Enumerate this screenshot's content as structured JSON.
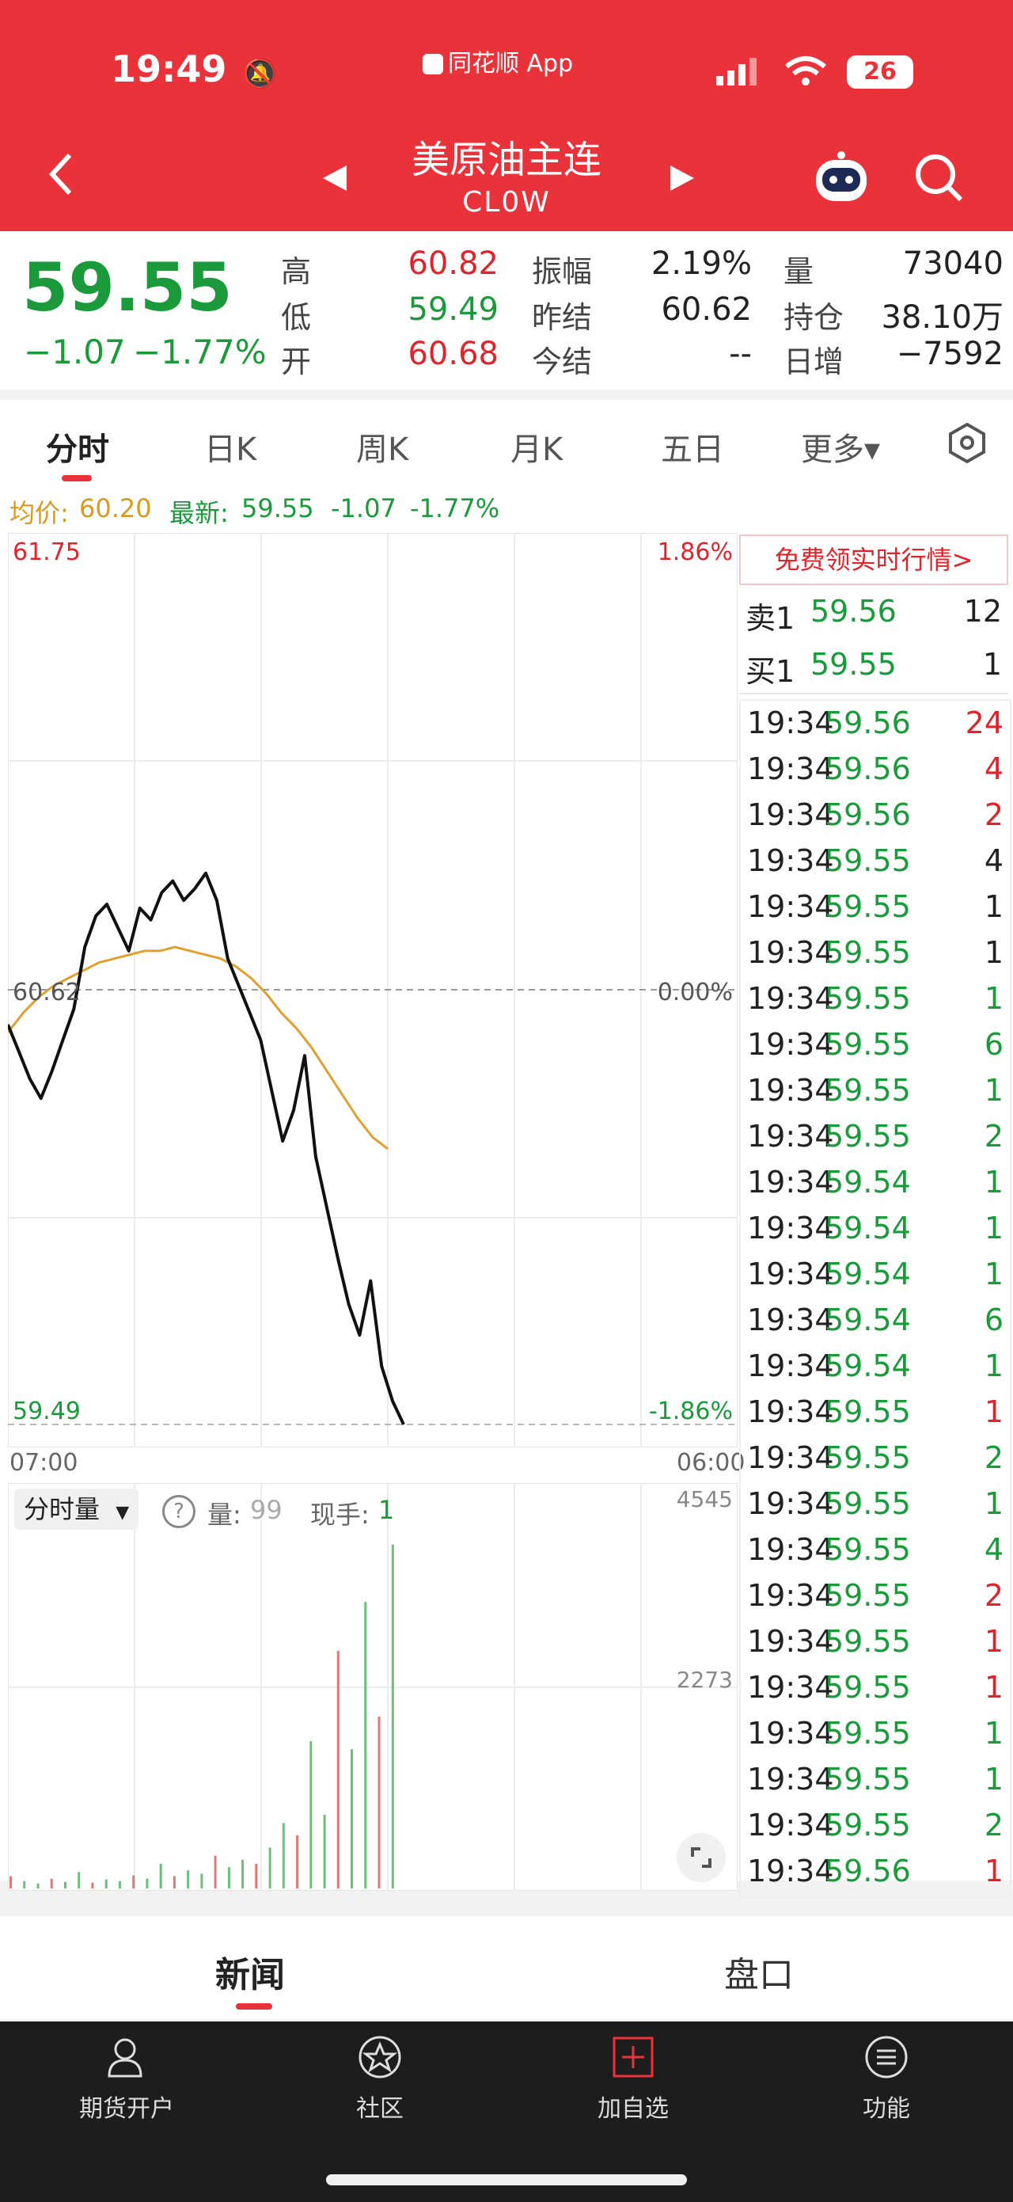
{
  "status": {
    "time": "19:49",
    "app_label": "同花顺 App",
    "battery": "26"
  },
  "header": {
    "title": "美原油主连",
    "code": "CL0W"
  },
  "quote": {
    "price": "59.55",
    "change": "−1.07",
    "change_pct": "−1.77%",
    "high_label": "高",
    "high": "60.82",
    "low_label": "低",
    "low": "59.49",
    "open_label": "开",
    "open": "60.68",
    "amp_label": "振幅",
    "amp": "2.19%",
    "prev_settle_label": "昨结",
    "prev_settle": "60.62",
    "settle_label": "今结",
    "settle": "--",
    "vol_label": "量",
    "vol": "73040",
    "oi_label": "持仓",
    "oi": "38.10万",
    "daily_inc_label": "日增",
    "daily_inc": "−7592"
  },
  "tabs": [
    "分时",
    "日K",
    "周K",
    "月K",
    "五日",
    "更多▾"
  ],
  "infoline": {
    "avg_label": "均价:",
    "avg": "60.20",
    "latest_label": "最新:",
    "latest": "59.55",
    "chg": "-1.07",
    "pct": "-1.77%"
  },
  "chart": {
    "y_top": "61.75",
    "y_mid": "60.62",
    "y_bot": "59.49",
    "pct_top": "1.86%",
    "pct_mid": "0.00%",
    "pct_bot": "-1.86%",
    "x_start": "07:00",
    "x_end": "06:00",
    "vol_mode": "分时量",
    "vol_label": "量:",
    "vol_val": "99",
    "hand_label": "现手:",
    "hand_val": "1",
    "vol_max": "4545",
    "vol_mid": "2273"
  },
  "chart_data": {
    "type": "line",
    "x_range": [
      "07:00",
      "06:00"
    ],
    "ylim": [
      59.49,
      61.75
    ],
    "series": [
      {
        "values": [
          60.52,
          60.45,
          60.38,
          60.33,
          60.4,
          60.48,
          60.56,
          60.72,
          60.8,
          60.83,
          60.77,
          60.71,
          60.82,
          60.79,
          60.86,
          60.89,
          60.84,
          60.87,
          60.91,
          60.84,
          60.69,
          60.62,
          60.55,
          60.48,
          60.35,
          60.22,
          60.3,
          60.44,
          60.18,
          60.05,
          59.92,
          59.8,
          59.72,
          59.86,
          59.64,
          59.55,
          59.49
        ]
      },
      {
        "values": [
          60.5,
          60.55,
          60.59,
          60.62,
          60.64,
          60.66,
          60.68,
          60.69,
          60.7,
          60.71,
          60.71,
          60.72,
          60.71,
          60.7,
          60.69,
          60.67,
          60.64,
          60.6,
          60.55,
          60.51,
          60.46,
          60.4,
          60.34,
          60.28,
          60.23,
          60.2
        ]
      }
    ],
    "volume": {
      "ylim": [
        0,
        4545
      ],
      "values": [
        150,
        90,
        60,
        120,
        80,
        200,
        70,
        110,
        90,
        160,
        120,
        300,
        150,
        220,
        180,
        400,
        260,
        350,
        300,
        500,
        800,
        650,
        1800,
        900,
        2900,
        1700,
        3500,
        2100,
        4200
      ]
    }
  },
  "book": {
    "promo": "免费领实时行情>",
    "ask": {
      "label": "卖1",
      "price": "59.56",
      "qty": "12"
    },
    "bid": {
      "label": "买1",
      "price": "59.55",
      "qty": "1"
    },
    "ticks": [
      {
        "t": "19:34",
        "p": "59.56",
        "q": "24",
        "pc": "#1a9a3a",
        "qc": "#e0242c"
      },
      {
        "t": "19:34",
        "p": "59.56",
        "q": "4",
        "pc": "#1a9a3a",
        "qc": "#e0242c"
      },
      {
        "t": "19:34",
        "p": "59.56",
        "q": "2",
        "pc": "#1a9a3a",
        "qc": "#e0242c"
      },
      {
        "t": "19:34",
        "p": "59.55",
        "q": "4",
        "pc": "#1a9a3a",
        "qc": "#222"
      },
      {
        "t": "19:34",
        "p": "59.55",
        "q": "1",
        "pc": "#1a9a3a",
        "qc": "#222"
      },
      {
        "t": "19:34",
        "p": "59.55",
        "q": "1",
        "pc": "#1a9a3a",
        "qc": "#222"
      },
      {
        "t": "19:34",
        "p": "59.55",
        "q": "1",
        "pc": "#1a9a3a",
        "qc": "#1a9a3a"
      },
      {
        "t": "19:34",
        "p": "59.55",
        "q": "6",
        "pc": "#1a9a3a",
        "qc": "#1a9a3a"
      },
      {
        "t": "19:34",
        "p": "59.55",
        "q": "1",
        "pc": "#1a9a3a",
        "qc": "#1a9a3a"
      },
      {
        "t": "19:34",
        "p": "59.55",
        "q": "2",
        "pc": "#1a9a3a",
        "qc": "#1a9a3a"
      },
      {
        "t": "19:34",
        "p": "59.54",
        "q": "1",
        "pc": "#1a9a3a",
        "qc": "#1a9a3a"
      },
      {
        "t": "19:34",
        "p": "59.54",
        "q": "1",
        "pc": "#1a9a3a",
        "qc": "#1a9a3a"
      },
      {
        "t": "19:34",
        "p": "59.54",
        "q": "1",
        "pc": "#1a9a3a",
        "qc": "#1a9a3a"
      },
      {
        "t": "19:34",
        "p": "59.54",
        "q": "6",
        "pc": "#1a9a3a",
        "qc": "#1a9a3a"
      },
      {
        "t": "19:34",
        "p": "59.54",
        "q": "1",
        "pc": "#1a9a3a",
        "qc": "#1a9a3a"
      },
      {
        "t": "19:34",
        "p": "59.55",
        "q": "1",
        "pc": "#1a9a3a",
        "qc": "#e0242c"
      },
      {
        "t": "19:34",
        "p": "59.55",
        "q": "2",
        "pc": "#1a9a3a",
        "qc": "#1a9a3a"
      },
      {
        "t": "19:34",
        "p": "59.55",
        "q": "1",
        "pc": "#1a9a3a",
        "qc": "#1a9a3a"
      },
      {
        "t": "19:34",
        "p": "59.55",
        "q": "4",
        "pc": "#1a9a3a",
        "qc": "#1a9a3a"
      },
      {
        "t": "19:34",
        "p": "59.55",
        "q": "2",
        "pc": "#1a9a3a",
        "qc": "#e0242c"
      },
      {
        "t": "19:34",
        "p": "59.55",
        "q": "1",
        "pc": "#1a9a3a",
        "qc": "#e0242c"
      },
      {
        "t": "19:34",
        "p": "59.55",
        "q": "1",
        "pc": "#1a9a3a",
        "qc": "#e0242c"
      },
      {
        "t": "19:34",
        "p": "59.55",
        "q": "1",
        "pc": "#1a9a3a",
        "qc": "#1a9a3a"
      },
      {
        "t": "19:34",
        "p": "59.55",
        "q": "1",
        "pc": "#1a9a3a",
        "qc": "#1a9a3a"
      },
      {
        "t": "19:34",
        "p": "59.55",
        "q": "2",
        "pc": "#1a9a3a",
        "qc": "#1a9a3a"
      },
      {
        "t": "19:34",
        "p": "59.56",
        "q": "1",
        "pc": "#1a9a3a",
        "qc": "#e0242c"
      }
    ]
  },
  "bottom_tabs": {
    "news": "新闻",
    "book": "盘口"
  },
  "nav": [
    {
      "label": "期货开户",
      "icon": "account-icon"
    },
    {
      "label": "社区",
      "icon": "community-icon"
    },
    {
      "label": "加自选",
      "icon": "add-watchlist-icon"
    },
    {
      "label": "功能",
      "icon": "menu-icon"
    }
  ],
  "colors": {
    "header": "#e9323a",
    "up": "#e0242c",
    "down": "#1a9a3a",
    "avg": "#e0a030"
  }
}
